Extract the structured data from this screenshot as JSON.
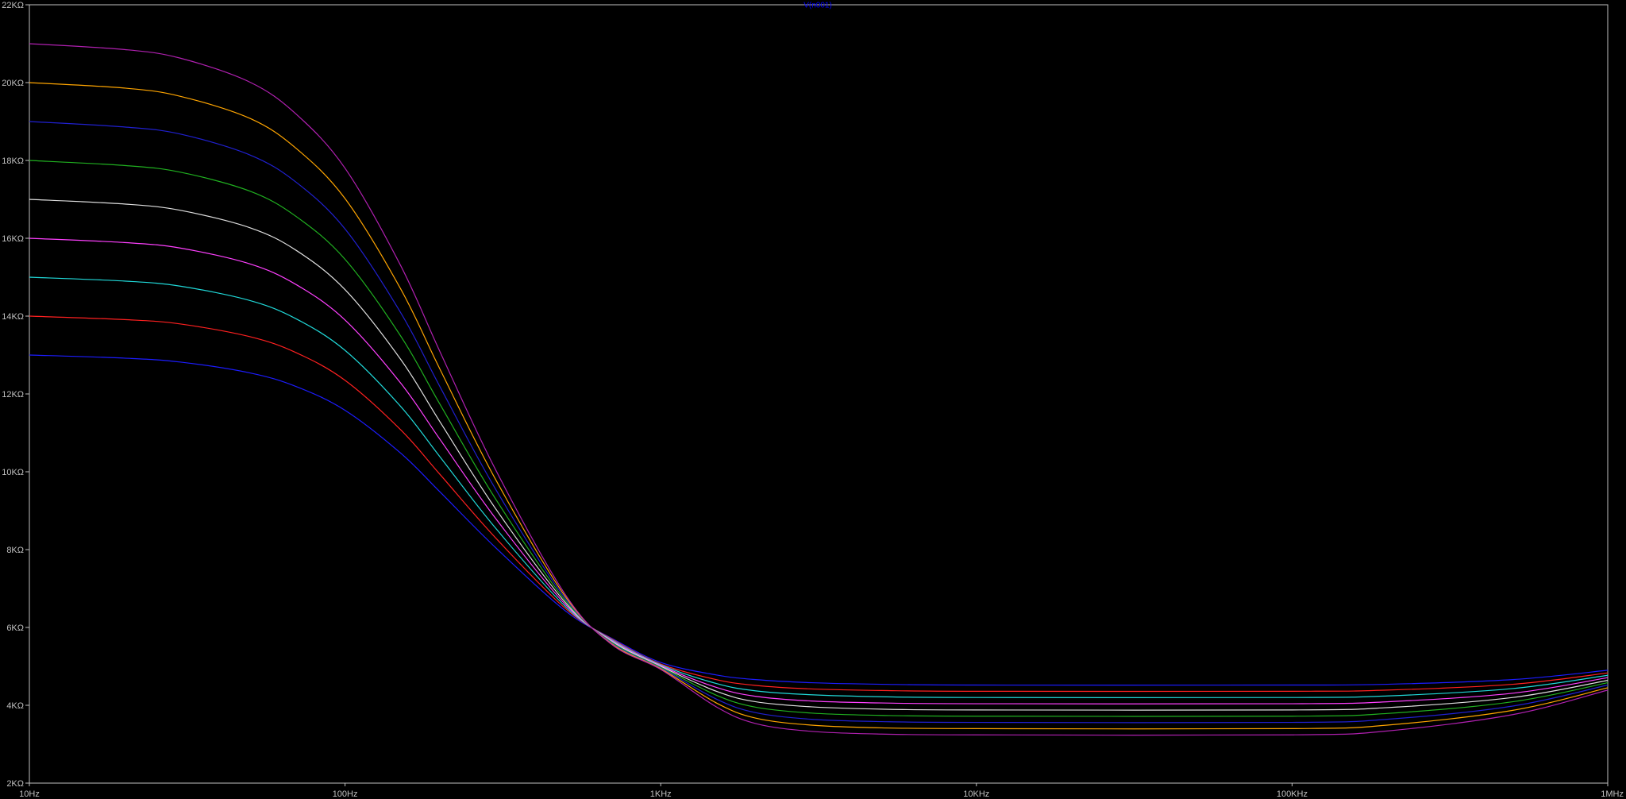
{
  "chart_data": {
    "type": "line",
    "title": "V(n001)",
    "x_scale": "log",
    "xlim": [
      10,
      1000000
    ],
    "ylim": [
      2000,
      22000
    ],
    "x_ticks": [
      {
        "value": 10,
        "label": "10Hz"
      },
      {
        "value": 100,
        "label": "100Hz"
      },
      {
        "value": 1000,
        "label": "1KHz"
      },
      {
        "value": 10000,
        "label": "10KHz"
      },
      {
        "value": 100000,
        "label": "100KHz"
      },
      {
        "value": 1000000,
        "label": "1MHz"
      }
    ],
    "y_ticks": [
      {
        "value": 2000,
        "label": "2KΩ"
      },
      {
        "value": 4000,
        "label": "4KΩ"
      },
      {
        "value": 6000,
        "label": "6KΩ"
      },
      {
        "value": 8000,
        "label": "8KΩ"
      },
      {
        "value": 10000,
        "label": "10KΩ"
      },
      {
        "value": 12000,
        "label": "12KΩ"
      },
      {
        "value": 14000,
        "label": "14KΩ"
      },
      {
        "value": 16000,
        "label": "16KΩ"
      },
      {
        "value": 18000,
        "label": "18KΩ"
      },
      {
        "value": 20000,
        "label": "20KΩ"
      },
      {
        "value": 22000,
        "label": "22KΩ"
      }
    ],
    "grid": false,
    "legend": "none",
    "colors": {
      "background": "#000000",
      "axis": "#c0c0c0",
      "tick_label": "#c0c0c0",
      "title": "#0000ff"
    },
    "x": [
      10,
      20,
      30,
      50,
      70,
      100,
      150,
      200,
      300,
      500,
      700,
      1000,
      1500,
      2000,
      3000,
      5000,
      10000,
      100000,
      200000,
      500000,
      1000000
    ],
    "series": [
      {
        "color": "#1c1cff",
        "values": [
          13000,
          12920,
          12820,
          12540,
          12190,
          11580,
          10480,
          9480,
          8050,
          6420,
          5720,
          5100,
          4780,
          4660,
          4580,
          4540,
          4520,
          4520,
          4540,
          4660,
          4900
        ]
      },
      {
        "color": "#ff2020",
        "values": [
          14000,
          13910,
          13800,
          13470,
          13060,
          12350,
          11080,
          9930,
          8300,
          6480,
          5700,
          5060,
          4660,
          4510,
          4420,
          4380,
          4360,
          4360,
          4390,
          4540,
          4830
        ]
      },
      {
        "color": "#20d8d8",
        "values": [
          15000,
          14900,
          14770,
          14400,
          13930,
          13120,
          11680,
          10380,
          8550,
          6530,
          5680,
          5040,
          4560,
          4370,
          4270,
          4220,
          4200,
          4200,
          4240,
          4430,
          4770
        ]
      },
      {
        "color": "#ff40ff",
        "values": [
          16000,
          15890,
          15750,
          15340,
          14810,
          13900,
          12280,
          10830,
          8800,
          6580,
          5660,
          5020,
          4460,
          4230,
          4110,
          4060,
          4040,
          4040,
          4090,
          4310,
          4710
        ]
      },
      {
        "color": "#e0e0e0",
        "values": [
          17000,
          16880,
          16720,
          16270,
          15690,
          14680,
          12890,
          11280,
          9050,
          6630,
          5640,
          5000,
          4360,
          4090,
          3960,
          3900,
          3880,
          3880,
          3940,
          4200,
          4640
        ]
      },
      {
        "color": "#20b020",
        "values": [
          18000,
          17870,
          17700,
          17210,
          16560,
          15460,
          13490,
          11730,
          9300,
          6680,
          5620,
          4980,
          4260,
          3950,
          3800,
          3740,
          3720,
          3720,
          3790,
          4090,
          4580
        ]
      },
      {
        "color": "#2020d0",
        "values": [
          19000,
          18860,
          18680,
          18140,
          17440,
          16240,
          14090,
          12180,
          9550,
          6730,
          5600,
          4960,
          4160,
          3810,
          3640,
          3580,
          3560,
          3560,
          3640,
          3980,
          4520
        ]
      },
      {
        "color": "#ffa500",
        "values": [
          20000,
          19860,
          19650,
          19080,
          18310,
          17020,
          14700,
          12630,
          9800,
          6780,
          5580,
          4940,
          4060,
          3670,
          3490,
          3420,
          3400,
          3400,
          3490,
          3870,
          4450
        ]
      },
      {
        "color": "#b020b0",
        "values": [
          21000,
          20850,
          20630,
          20010,
          19190,
          17800,
          15300,
          13080,
          10050,
          6830,
          5560,
          4920,
          3960,
          3530,
          3330,
          3260,
          3240,
          3240,
          3340,
          3760,
          4390
        ]
      }
    ]
  }
}
